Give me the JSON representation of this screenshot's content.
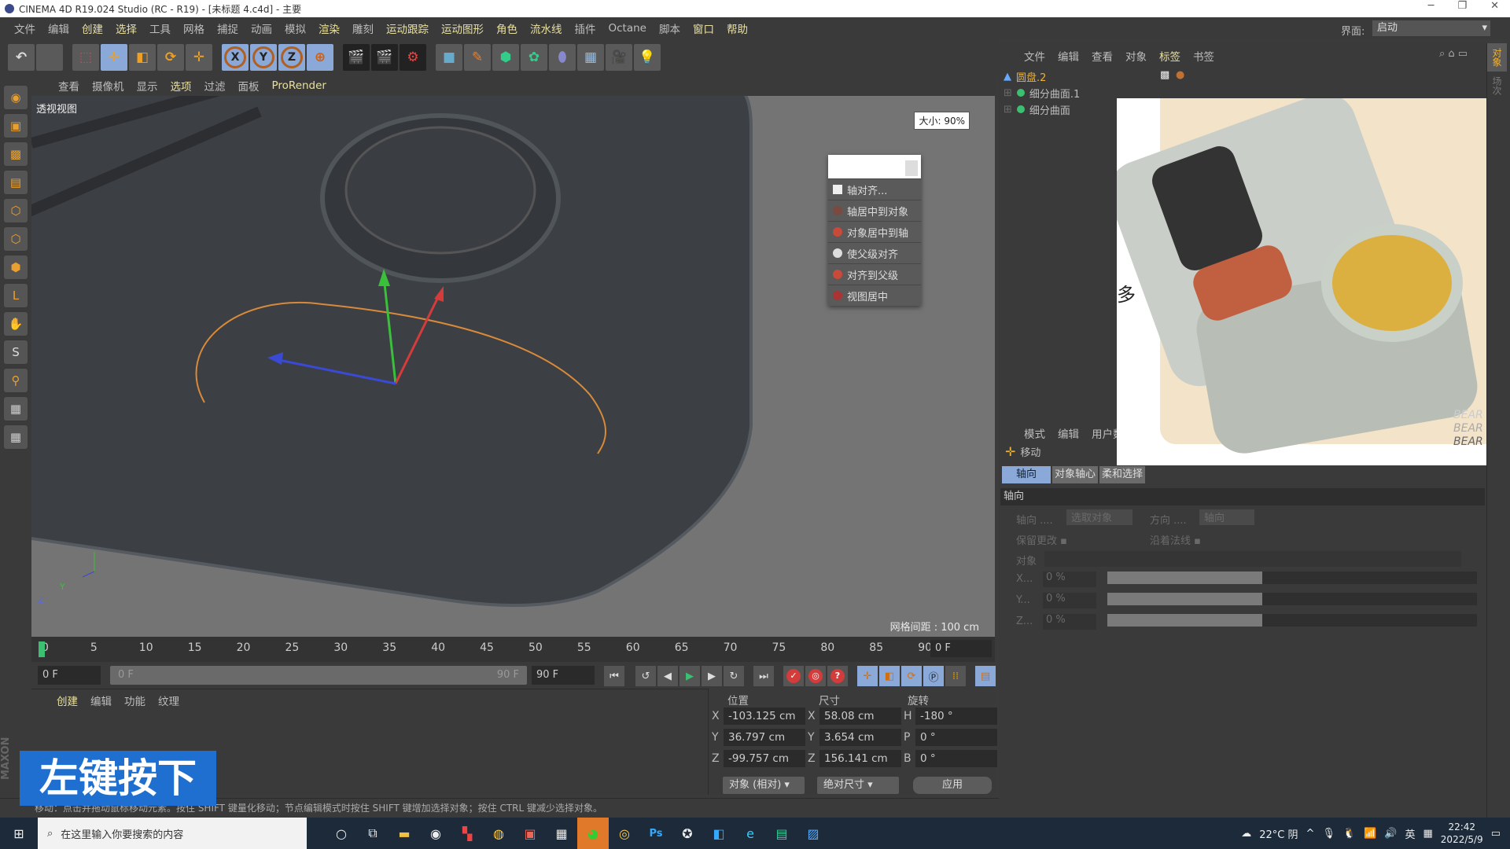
{
  "window": {
    "title": "CINEMA 4D R19.024 Studio (RC - R19) - [未标题 4.c4d] - 主要",
    "controls": [
      "─",
      "❐",
      "✕"
    ]
  },
  "menubar": {
    "items": [
      {
        "label": "文件",
        "hl": false
      },
      {
        "label": "编辑",
        "hl": false
      },
      {
        "label": "创建",
        "hl": true
      },
      {
        "label": "选择",
        "hl": true
      },
      {
        "label": "工具",
        "hl": false
      },
      {
        "label": "网格",
        "hl": false
      },
      {
        "label": "捕捉",
        "hl": false
      },
      {
        "label": "动画",
        "hl": false
      },
      {
        "label": "模拟",
        "hl": false
      },
      {
        "label": "渲染",
        "hl": true
      },
      {
        "label": "雕刻",
        "hl": false
      },
      {
        "label": "运动跟踪",
        "hl": true
      },
      {
        "label": "运动图形",
        "hl": true
      },
      {
        "label": "角色",
        "hl": true
      },
      {
        "label": "流水线",
        "hl": true
      },
      {
        "label": "插件",
        "hl": false
      },
      {
        "label": "Octane",
        "hl": false
      },
      {
        "label": "脚本",
        "hl": false
      },
      {
        "label": "窗口",
        "hl": true
      },
      {
        "label": "帮助",
        "hl": true
      }
    ],
    "interface_label": "界面:",
    "interface_value": "启动"
  },
  "toolbar": {
    "axis_labels": [
      "X",
      "Y",
      "Z"
    ]
  },
  "viewport": {
    "menu": [
      "查看",
      "摄像机",
      "显示",
      "选项",
      "过滤",
      "面板",
      "ProRender"
    ],
    "active_menu": "选项",
    "view_name": "透视视图",
    "size_badge": "大小: 90%",
    "grid_spacing": "网格间距 : 100 cm",
    "axis_gizmo": [
      "Y",
      "Z"
    ],
    "spline_color": "#d88a3a"
  },
  "context_menu": {
    "items": [
      "轴对齐...",
      "轴居中到对象",
      "对象居中到轴",
      "使父级对齐",
      "对齐到父级",
      "视图居中"
    ]
  },
  "timeline": {
    "ticks": [
      0,
      5,
      10,
      15,
      20,
      25,
      30,
      35,
      40,
      45,
      50,
      55,
      60,
      65,
      70,
      75,
      80,
      85,
      90
    ],
    "current_frame": "0 F",
    "start": "0 F",
    "range_start": "0 F",
    "range_end": "90 F",
    "end": "90 F"
  },
  "material_panel": {
    "menu": [
      "创建",
      "编辑",
      "功能",
      "纹理"
    ]
  },
  "coordinates": {
    "headers": [
      "位置",
      "尺寸",
      "旋转"
    ],
    "rows": [
      {
        "pl": "X",
        "pos": "-103.125 cm",
        "sl": "X",
        "size": "58.08 cm",
        "rl": "H",
        "rot": "-180 °"
      },
      {
        "pl": "Y",
        "pos": "36.797 cm",
        "sl": "Y",
        "size": "3.654 cm",
        "rl": "P",
        "rot": "0 °"
      },
      {
        "pl": "Z",
        "pos": "-99.757 cm",
        "sl": "Z",
        "size": "156.141 cm",
        "rl": "B",
        "rot": "0 °"
      }
    ],
    "mode": "对象 (相对)",
    "size_mode": "绝对尺寸",
    "apply": "应用"
  },
  "status": "移动：点击并拖动鼠标移动元素。按住 SHIFT 键量化移动；节点编辑模式时按住 SHIFT 键增加选择对象；按住 CTRL 键减少选择对象。",
  "overlay_caption": "左键按下",
  "maxon_logo": "MAXON CINEMA 4D",
  "object_manager": {
    "menu": [
      "文件",
      "编辑",
      "查看",
      "对象",
      "标签",
      "书签"
    ],
    "objects": [
      {
        "name": "圆盘.2",
        "selected": true
      },
      {
        "name": "细分曲面.1",
        "selected": false
      },
      {
        "name": "细分曲面",
        "selected": false
      }
    ]
  },
  "right_tabs": [
    "对象",
    "场次"
  ],
  "photo": {
    "brand": [
      "BEAR",
      "BEAR",
      "BEAR"
    ],
    "side_char": "多"
  },
  "attributes": {
    "menu": [
      "模式",
      "编辑",
      "用户数据"
    ],
    "tool": "移动",
    "tabs": [
      "轴向",
      "对象轴心",
      "柔和选择"
    ],
    "section": "轴向",
    "axis_label": "轴向 ....",
    "axis_value": "选取对象",
    "dir_label": "方向 ....",
    "dir_value": "轴向",
    "keep_changes": "保留更改",
    "along_normal": "沿着法线",
    "object_label": "对象",
    "sliders": [
      {
        "label": "X...",
        "value": "0 %",
        "fill": 0.42
      },
      {
        "label": "Y...",
        "value": "0 %",
        "fill": 0.42
      },
      {
        "label": "Z...",
        "value": "0 %",
        "fill": 0.42
      }
    ]
  },
  "taskbar": {
    "search_placeholder": "在这里输入你要搜索的内容",
    "weather": "22°C 阴",
    "ime": "英",
    "time": "22:42",
    "date": "2022/5/9"
  }
}
